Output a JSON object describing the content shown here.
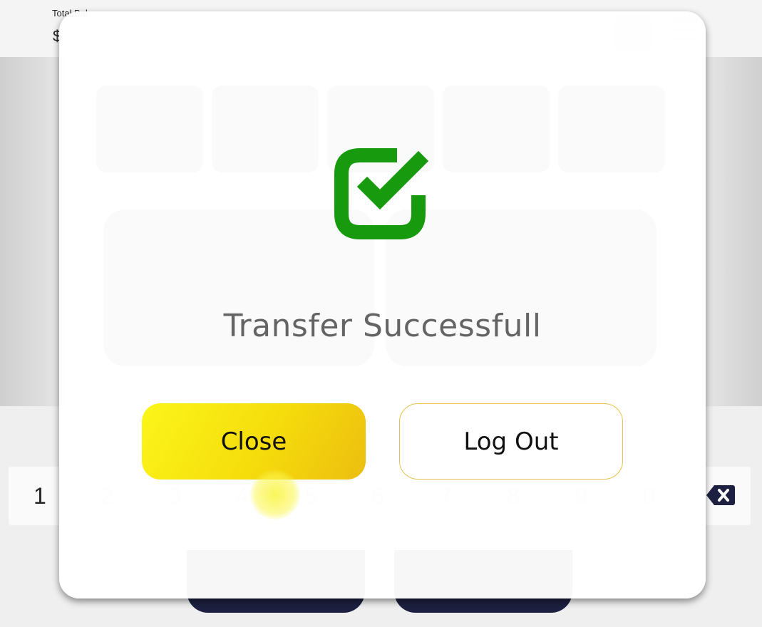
{
  "header": {
    "total_balance_label": "Total Bal",
    "balance_value": "$"
  },
  "keypad": {
    "keys": [
      "1",
      "2",
      "3",
      "4",
      "5",
      "6",
      "7",
      "8",
      "9",
      "0"
    ]
  },
  "bottom": {
    "left_label": "",
    "right_label": ""
  },
  "modal": {
    "icon": "check-square-icon",
    "title": "Transfer Successfull",
    "close_label": "Close",
    "logout_label": "Log Out"
  },
  "colors": {
    "success_green": "#179a0e",
    "close_yellow": "#f7e80f",
    "logout_border": "#e8c24a",
    "title_gray": "#646464"
  }
}
